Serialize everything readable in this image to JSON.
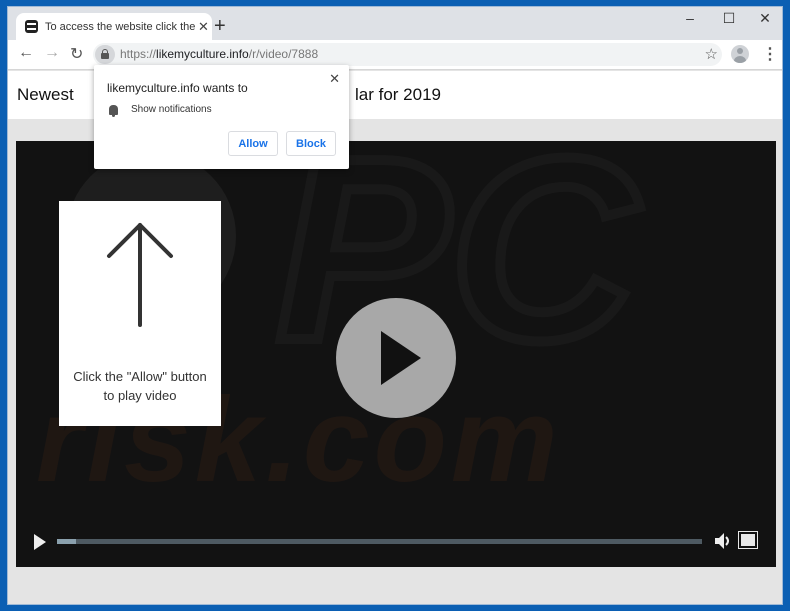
{
  "browser": {
    "tab": {
      "title": "To access the website click the \"Allow\" button",
      "favicon": "site-favicon-icon"
    },
    "window_controls": {
      "minimize": "–",
      "maximize": "☐",
      "close": "✕"
    },
    "nav": {
      "back": "←",
      "forward": "→",
      "reload": "↻"
    },
    "omnibox": {
      "scheme": "https://",
      "domain": "likemyculture.info",
      "path": "/r/video/7888"
    },
    "bookmark_icon": "☆",
    "menu_icon": "⋮"
  },
  "page": {
    "header_left": "Newest",
    "header_right": "lar for 2019",
    "hint": {
      "line1": "Click the \"Allow\" button",
      "line2": "to play video"
    },
    "video": {
      "progress_fraction": 0.03
    }
  },
  "popup": {
    "title": "likemyculture.info wants to",
    "permission": "Show notifications",
    "close": "✕",
    "allow_label": "Allow",
    "block_label": "Block"
  }
}
